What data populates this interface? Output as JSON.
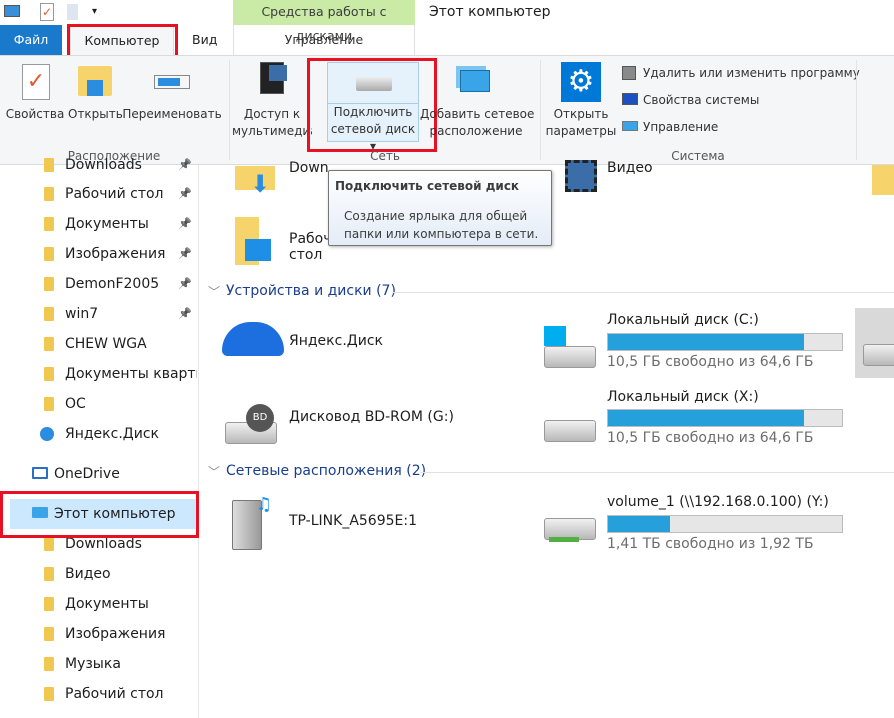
{
  "window": {
    "title": "Этот компьютер",
    "context_tab": "Средства работы с дисками"
  },
  "tabs": {
    "file": "Файл",
    "computer": "Компьютер",
    "view": "Вид",
    "manage": "Управление"
  },
  "ribbon": {
    "location": {
      "label": "Расположение",
      "properties": "Свойства",
      "open": "Открыть",
      "rename": "Переименовать"
    },
    "network": {
      "label": "Сеть",
      "media_line1": "Доступ к",
      "media_line2": "мультимедиа",
      "map_line1": "Подключить",
      "map_line2": "сетевой диск",
      "add_line1": "Добавить сетевое",
      "add_line2": "расположение"
    },
    "system": {
      "label": "Система",
      "open_line1": "Открыть",
      "open_line2": "параметры",
      "uninstall": "Удалить или изменить программу",
      "sysprops": "Свойства системы",
      "manage": "Управление"
    }
  },
  "tooltip": {
    "title": "Подключить сетевой диск",
    "line1": "Создание ярлыка для общей",
    "line2": "папки или компьютера в сети."
  },
  "sidebar": {
    "items": [
      {
        "label": "Downloads"
      },
      {
        "label": "Рабочий стол"
      },
      {
        "label": "Документы"
      },
      {
        "label": "Изображения"
      },
      {
        "label": "DemonF2005"
      },
      {
        "label": "win7"
      },
      {
        "label": "CHEW WGA"
      },
      {
        "label": "Документы кварти"
      },
      {
        "label": "OC"
      },
      {
        "label": "Яндекс.Диск"
      },
      {
        "label": "OneDrive"
      },
      {
        "label": "Этот компьютер"
      },
      {
        "label": "Downloads"
      },
      {
        "label": "Видео"
      },
      {
        "label": "Документы"
      },
      {
        "label": "Изображения"
      },
      {
        "label": "Музыка"
      },
      {
        "label": "Рабочий стол"
      }
    ]
  },
  "folders": {
    "downloads": "Downloads",
    "desktop": "Рабочий стол",
    "video": "Видео"
  },
  "devices": {
    "header": "Устройства и диски (7)",
    "yandex": "Яндекс.Диск",
    "bd": "Дисковод BD-ROM (G:)",
    "c": {
      "label": "Локальный диск (C:)",
      "free": "10,5 ГБ свободно из 64,6 ГБ",
      "used_pct": 83.7
    },
    "x": {
      "label": "Локальный диск (X:)",
      "free": "10,5 ГБ свободно из 64,6 ГБ",
      "used_pct": 83.7
    }
  },
  "network": {
    "header": "Сетевые расположения (2)",
    "tplink": "TP-LINK_A5695E:1",
    "vol": {
      "label": "volume_1 (\\\\192.168.0.100) (Y:)",
      "free": "1,41 ТБ свободно из 1,92 ТБ",
      "used_pct": 26.6
    }
  },
  "colors": {
    "accent": "#1979ca",
    "highlight": "#e81123",
    "context_tab": "#c9eba6",
    "bar_fill": "#26a0da"
  }
}
